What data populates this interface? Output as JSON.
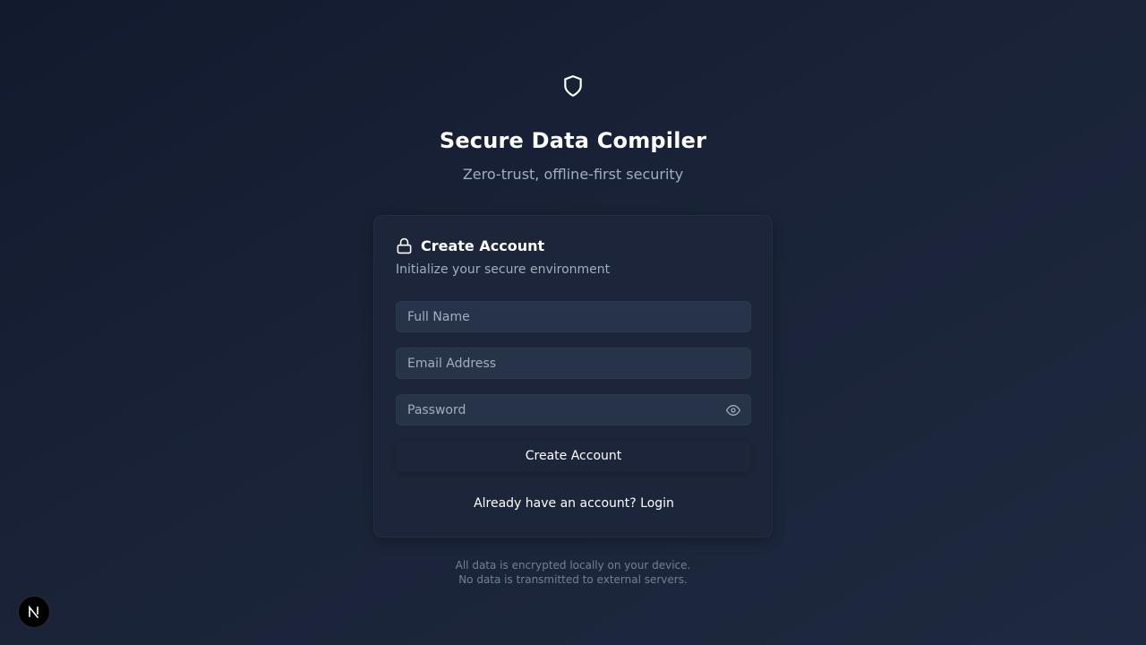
{
  "brand": {
    "icon": "shield-icon",
    "title": "Secure Data Compiler",
    "subtitle": "Zero-trust, offline-first security"
  },
  "card": {
    "icon": "lock-icon",
    "title": "Create Account",
    "description": "Initialize your secure environment",
    "fields": {
      "full_name": {
        "placeholder": "Full Name",
        "value": ""
      },
      "email": {
        "placeholder": "Email Address",
        "value": ""
      },
      "password": {
        "placeholder": "Password",
        "value": "",
        "toggle_icon": "eye-icon"
      }
    },
    "submit_label": "Create Account",
    "switch_link": "Already have an account? Login"
  },
  "footer": {
    "line1": "All data is encrypted locally on your device.",
    "line2": "No data is transmitted to external servers."
  },
  "dev_badge": {
    "icon": "nextjs-n-icon",
    "letter": "N"
  },
  "colors": {
    "background": "#161f33",
    "card": "#1c2539",
    "input": "#273349",
    "muted_text": "#a0aec0",
    "footer_text": "#718096"
  }
}
